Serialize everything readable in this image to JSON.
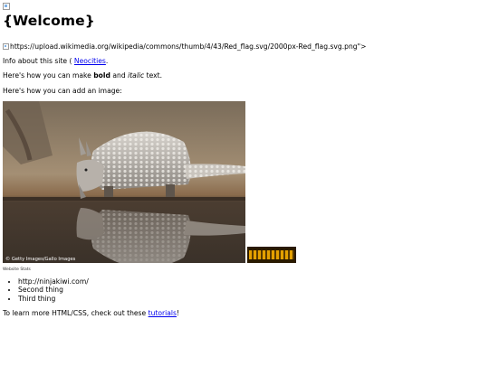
{
  "page": {
    "title": "{Welcome}",
    "broken_image_alt": "https://upload.wikimedia.org/wikipedia/commons/thumb/4/43/Red_flag.svg/2000px-Red_flag.svg.png\">",
    "info_text_before": "Info about this site ( ",
    "info_link": "Neocities",
    "info_text_after": ".",
    "bold_line": {
      "before": "Here's how you can make ",
      "bold": "bold",
      "middle": " and ",
      "italic": "italic",
      "after": " text."
    },
    "image_intro": "Here's how you can add an image:",
    "photo_credit": "© Getty Images/Gallo Images",
    "caption": "Website Stats",
    "list_items": [
      "http://ninjakiwi.com/",
      "Second thing",
      "Third thing"
    ],
    "footer": {
      "before": "To learn more HTML/CSS, check out these ",
      "link": "tutorials",
      "after": "!"
    }
  },
  "colors": {
    "link": "#0000ee",
    "text": "#000000",
    "background": "#ffffff"
  }
}
